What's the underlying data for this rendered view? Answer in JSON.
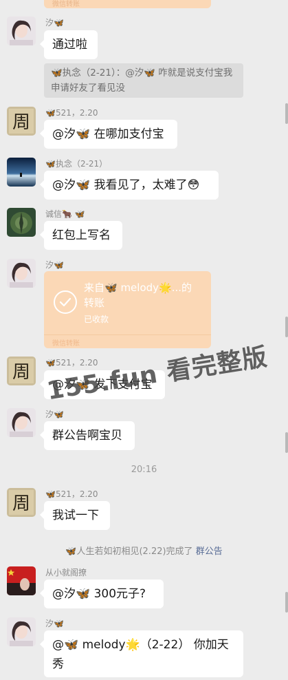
{
  "top_transfer": {
    "footer": "微信转账"
  },
  "messages": [
    {
      "sender": "汐🦋",
      "text": "通过啦"
    },
    {
      "quote": "🦋执念（2-21）：@汐🦋 咋就是说支付宝我申请好友了看见没"
    },
    {
      "sender": "🦋521，2.20",
      "text": "@汐🦋 在哪加支付宝"
    },
    {
      "sender": "🦋执念（2-21）",
      "text": "@汐🦋 我看见了，太难了😳"
    },
    {
      "sender": "诚信🐂 🦋",
      "text": "红包上写名"
    },
    {
      "sender": "汐🦋",
      "transfer": {
        "title": "来自🦋 melody🌟...的转账",
        "title_line1": "来自🦋 melody🌟...的",
        "title_line2": "转账",
        "status": "已收款",
        "footer": "微信转账"
      }
    },
    {
      "sender": "🦋521，2.20",
      "text": "@汐🦋 发下支付宝"
    },
    {
      "sender": "汐🦋",
      "text": "群公告啊宝贝"
    },
    {
      "time": "20:16"
    },
    {
      "sender": "🦋521，2.20",
      "text": "我试一下"
    },
    {
      "system": "🦋人生若如初相见(2.22)完成了",
      "system_link": "群公告"
    },
    {
      "sender": "从小就阁撩",
      "text": "@汐🦋 300元子?"
    },
    {
      "sender": "汐🦋",
      "text_line1": "@🦋 melody🌟（2-22） 你加天",
      "text_line2": "秀"
    }
  ],
  "watermark": "155.fun 看完整版",
  "colors": {
    "background": "#ececec",
    "bubble": "#ffffff",
    "transfer": "#fbd8b6",
    "link": "#576b95"
  }
}
